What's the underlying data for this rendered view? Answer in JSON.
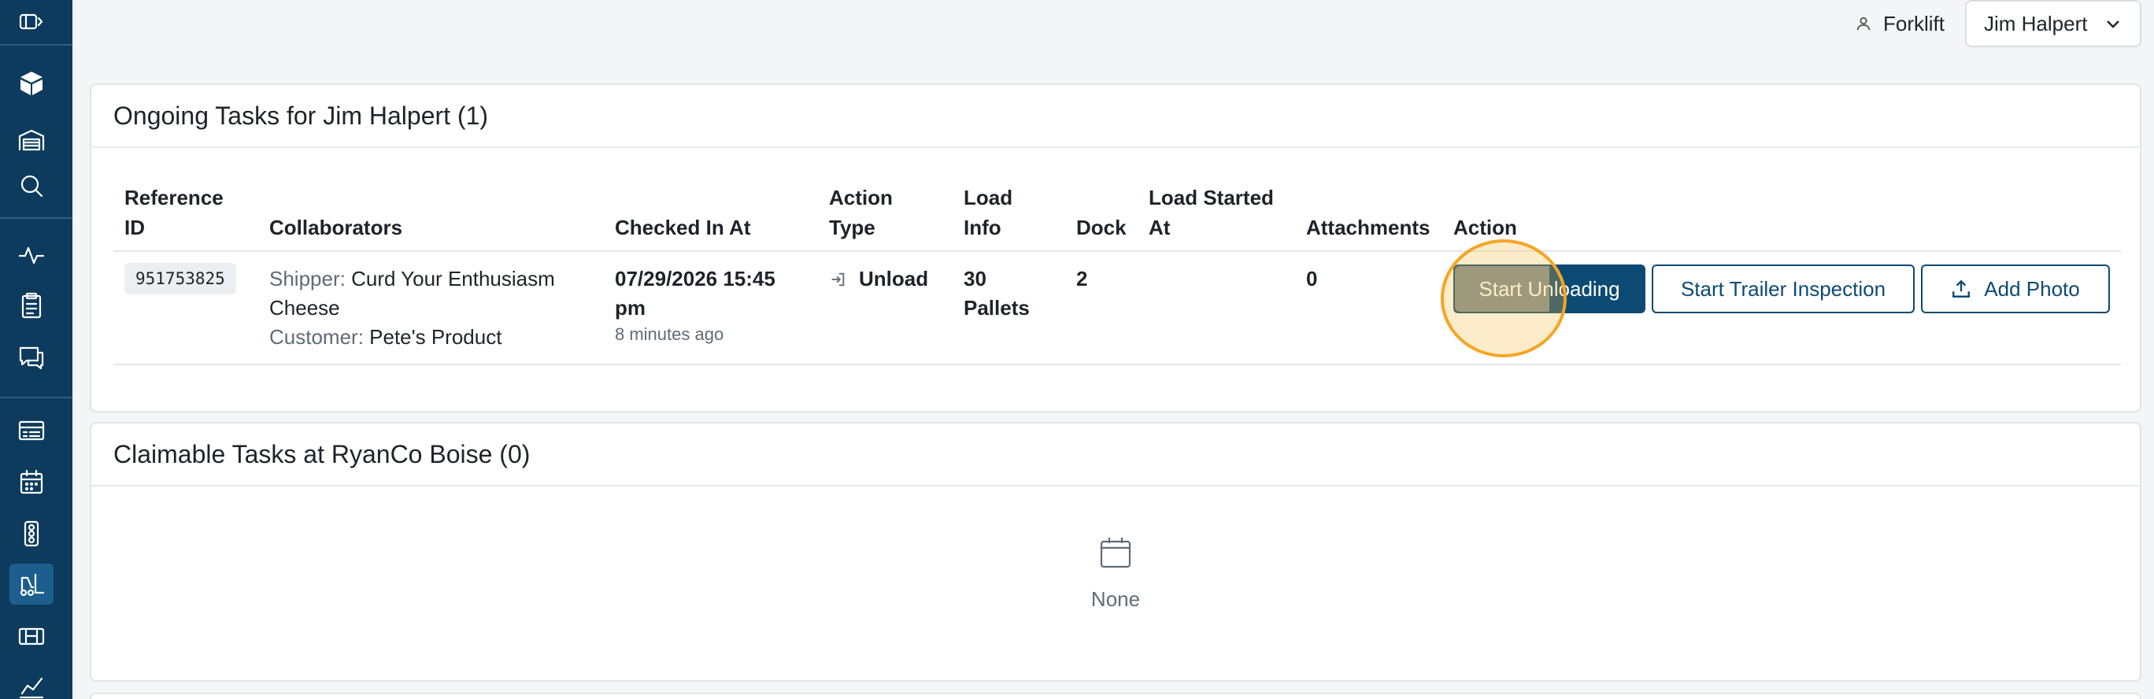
{
  "sidebar": {
    "items": [
      {
        "icon": "panel-toggle-icon"
      },
      {
        "icon": "logo-icon"
      },
      {
        "icon": "warehouse-icon"
      },
      {
        "icon": "search-icon"
      },
      {
        "icon": "activity-icon"
      },
      {
        "icon": "clipboard-icon"
      },
      {
        "icon": "messages-icon"
      },
      {
        "icon": "receipt-list-icon"
      },
      {
        "icon": "calendar-icon"
      },
      {
        "icon": "traffic-light-icon"
      },
      {
        "icon": "forklift-icon",
        "active": true
      },
      {
        "icon": "dock-door-icon"
      },
      {
        "icon": "chart-icon"
      }
    ]
  },
  "topbar": {
    "role": "Forklift",
    "user": "Jim Halpert"
  },
  "ongoing": {
    "title": "Ongoing Tasks for Jim Halpert (1)",
    "columns": {
      "reference_id_1": "Reference",
      "reference_id_2": "ID",
      "collaborators": "Collaborators",
      "checked_in_at": "Checked In At",
      "action_type_1": "Action",
      "action_type_2": "Type",
      "load_info_1": "Load",
      "load_info_2": "Info",
      "dock": "Dock",
      "load_started_1": "Load Started",
      "load_started_2": "At",
      "attachments": "Attachments",
      "action": "Action"
    },
    "row": {
      "reference_id": "951753825",
      "shipper_label": "Shipper:",
      "shipper_value_1": "Curd Your Enthusiasm",
      "shipper_value_2": "Cheese",
      "customer_label": "Customer:",
      "customer_value": "Pete's Product",
      "checked_in_1": "07/29/2026 15:45",
      "checked_in_2": "pm",
      "checked_in_ago": "8 minutes ago",
      "action_type": "Unload",
      "load_info_1": "30",
      "load_info_2": "Pallets",
      "dock": "2",
      "load_started_at": "",
      "attachments": "0",
      "btn_start_unloading": "Start Unloading",
      "btn_trailer_inspection": "Start Trailer Inspection",
      "btn_add_photo": "Add Photo"
    }
  },
  "claimable": {
    "title": "Claimable Tasks at RyanCo Boise (0)",
    "empty_text": "None"
  },
  "colors": {
    "sidebar": "#0d3b5e",
    "primary": "#0d4a73",
    "highlight": "#f5a524"
  }
}
